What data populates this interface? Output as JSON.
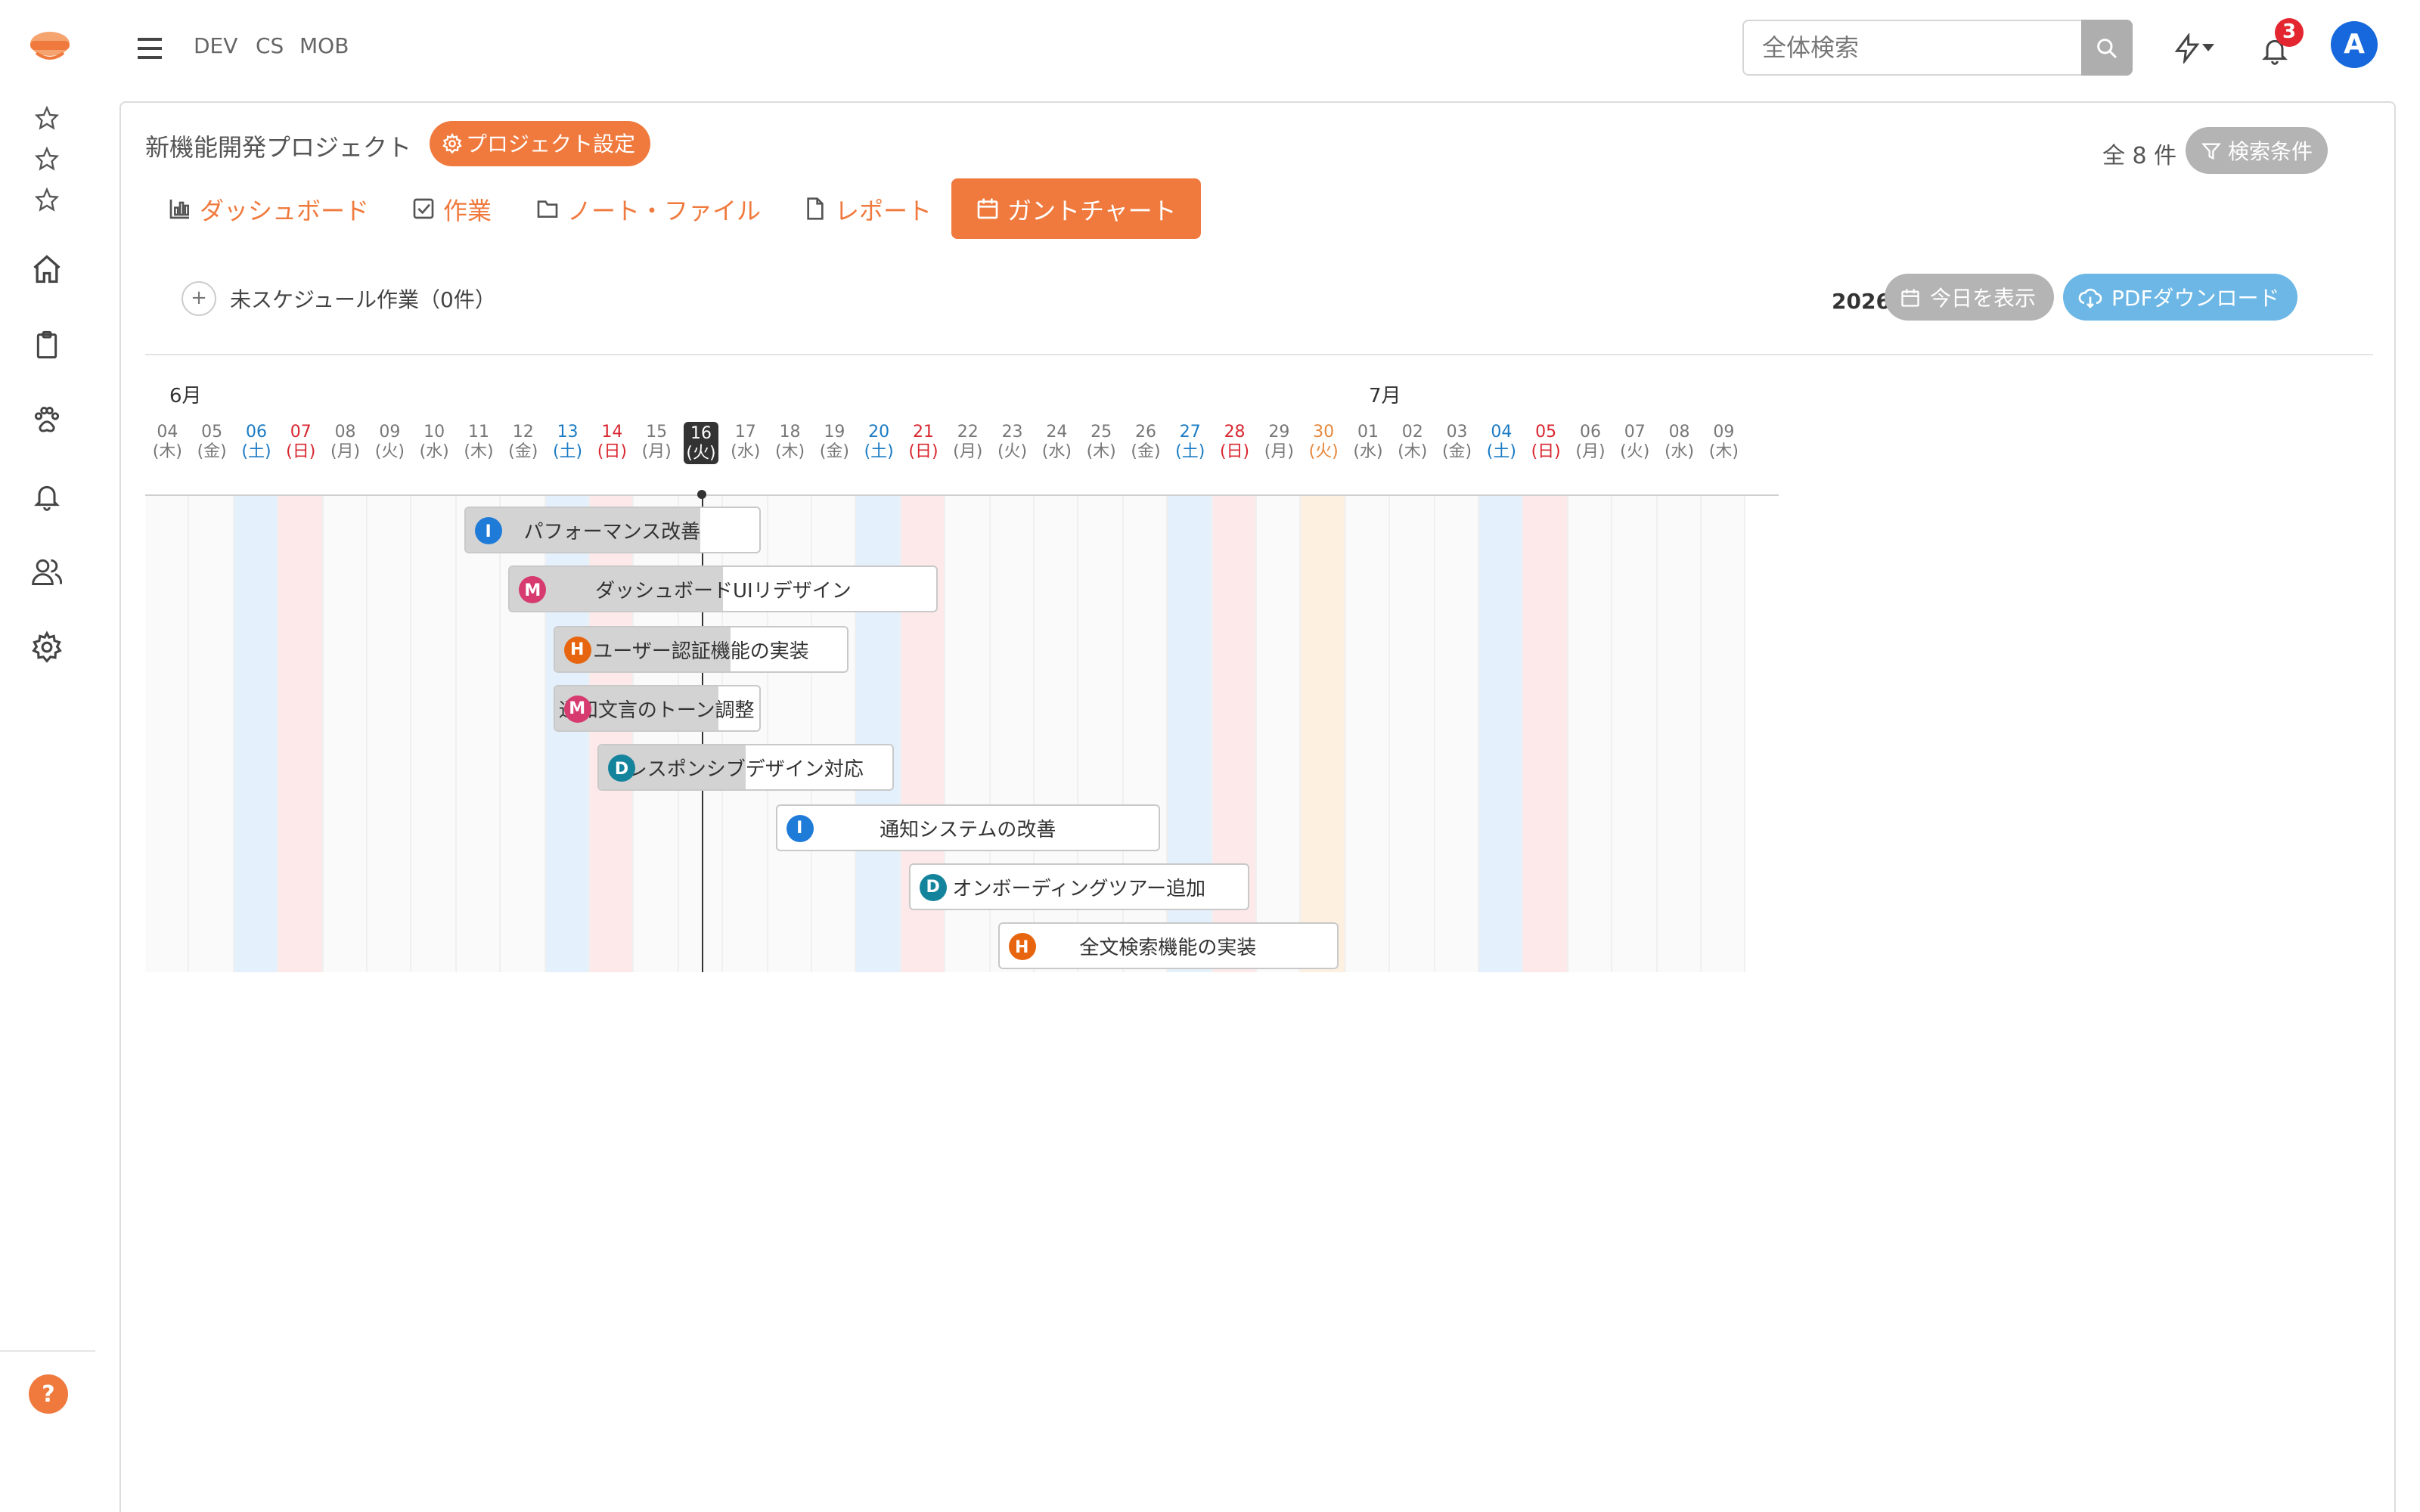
{
  "header": {
    "projects": [
      "DEV",
      "CS",
      "MOB"
    ],
    "search_placeholder": "全体検索",
    "notification_count": "3",
    "avatar_initial": "A"
  },
  "project": {
    "title": "新機能開発プロジェクト",
    "settings_label": "プロジェクト設定",
    "total_count": "全 8 件",
    "filter_label": "検索条件"
  },
  "tabs": [
    {
      "label": "ダッシュボード",
      "icon": "bar-chart-icon",
      "active": false
    },
    {
      "label": "作業",
      "icon": "checkbox-icon",
      "active": false
    },
    {
      "label": "ノート・ファイル",
      "icon": "folder-icon",
      "active": false
    },
    {
      "label": "レポート",
      "icon": "document-icon",
      "active": false
    },
    {
      "label": "ガントチャート",
      "icon": "calendar-icon",
      "active": true
    }
  ],
  "toolbar": {
    "unscheduled_label": "未スケジュール作業（0件）",
    "year_label": "2026年",
    "today_label": "今日を表示",
    "pdf_label": "PDFダウンロード"
  },
  "gantt": {
    "months": [
      "6月",
      "7月"
    ],
    "today": "2026-06-16",
    "days": [
      {
        "d": "04",
        "w": "(木)",
        "type": "weekday"
      },
      {
        "d": "05",
        "w": "(金)",
        "type": "weekday"
      },
      {
        "d": "06",
        "w": "(土)",
        "type": "sat"
      },
      {
        "d": "07",
        "w": "(日)",
        "type": "sun"
      },
      {
        "d": "08",
        "w": "(月)",
        "type": "weekday"
      },
      {
        "d": "09",
        "w": "(火)",
        "type": "weekday"
      },
      {
        "d": "10",
        "w": "(水)",
        "type": "weekday"
      },
      {
        "d": "11",
        "w": "(木)",
        "type": "weekday"
      },
      {
        "d": "12",
        "w": "(金)",
        "type": "weekday"
      },
      {
        "d": "13",
        "w": "(土)",
        "type": "sat"
      },
      {
        "d": "14",
        "w": "(日)",
        "type": "sun"
      },
      {
        "d": "15",
        "w": "(月)",
        "type": "weekday"
      },
      {
        "d": "16",
        "w": "(火)",
        "type": "today"
      },
      {
        "d": "17",
        "w": "(水)",
        "type": "weekday"
      },
      {
        "d": "18",
        "w": "(木)",
        "type": "weekday"
      },
      {
        "d": "19",
        "w": "(金)",
        "type": "weekday"
      },
      {
        "d": "20",
        "w": "(土)",
        "type": "sat"
      },
      {
        "d": "21",
        "w": "(日)",
        "type": "sun"
      },
      {
        "d": "22",
        "w": "(月)",
        "type": "weekday"
      },
      {
        "d": "23",
        "w": "(火)",
        "type": "weekday"
      },
      {
        "d": "24",
        "w": "(水)",
        "type": "weekday"
      },
      {
        "d": "25",
        "w": "(木)",
        "type": "weekday"
      },
      {
        "d": "26",
        "w": "(金)",
        "type": "weekday"
      },
      {
        "d": "27",
        "w": "(土)",
        "type": "sat"
      },
      {
        "d": "28",
        "w": "(日)",
        "type": "sun"
      },
      {
        "d": "29",
        "w": "(月)",
        "type": "weekday"
      },
      {
        "d": "30",
        "w": "(火)",
        "type": "hol"
      },
      {
        "d": "01",
        "w": "(水)",
        "type": "weekday"
      },
      {
        "d": "02",
        "w": "(木)",
        "type": "weekday"
      },
      {
        "d": "03",
        "w": "(金)",
        "type": "weekday"
      },
      {
        "d": "04",
        "w": "(土)",
        "type": "sat"
      },
      {
        "d": "05",
        "w": "(日)",
        "type": "sun"
      },
      {
        "d": "06",
        "w": "(月)",
        "type": "weekday"
      },
      {
        "d": "07",
        "w": "(火)",
        "type": "weekday"
      },
      {
        "d": "08",
        "w": "(水)",
        "type": "weekday"
      },
      {
        "d": "09",
        "w": "(木)",
        "type": "weekday"
      }
    ],
    "tasks": [
      {
        "name": "パフォーマンス改善",
        "priority": "I",
        "priority_color": "#1f7bd8",
        "start": "2026-06-11",
        "end": "2026-06-17",
        "progress": 0.8
      },
      {
        "name": "ダッシュボードUIリデザイン",
        "priority": "M",
        "priority_color": "#d63a6e",
        "start": "2026-06-12",
        "end": "2026-06-21",
        "progress": 0.5
      },
      {
        "name": "ユーザー認証機能の実装",
        "priority": "H",
        "priority_color": "#e8650f",
        "start": "2026-06-13",
        "end": "2026-06-19",
        "progress": 0.6
      },
      {
        "name": "通知文言のトーン調整",
        "priority": "M",
        "priority_color": "#d63a6e",
        "start": "2026-06-13",
        "end": "2026-06-17",
        "progress": 0.8
      },
      {
        "name": "レスポンシブデザイン対応",
        "priority": "D",
        "priority_color": "#14849c",
        "start": "2026-06-14",
        "end": "2026-06-20",
        "progress": 0.5
      },
      {
        "name": "通知システムの改善",
        "priority": "I",
        "priority_color": "#1f7bd8",
        "start": "2026-06-18",
        "end": "2026-06-26",
        "progress": 0
      },
      {
        "name": "オンボーディングツアー追加",
        "priority": "D",
        "priority_color": "#14849c",
        "start": "2026-06-21",
        "end": "2026-06-28",
        "progress": 0
      },
      {
        "name": "全文検索機能の実装",
        "priority": "H",
        "priority_color": "#e8650f",
        "start": "2026-06-23",
        "end": "2026-06-30",
        "progress": 0
      }
    ]
  },
  "colors": {
    "accent": "#f07a3e",
    "saturday": "#1a7bc4",
    "sunday": "#d9262f",
    "holiday": "#e6873a",
    "avatar": "#1668dc"
  },
  "sidebar": {
    "icons": [
      "star-icon",
      "star-icon",
      "star-icon",
      "home-icon",
      "clipboard-icon",
      "paw-icon",
      "bell-icon",
      "users-icon",
      "gear-icon"
    ],
    "help_label": "?"
  }
}
